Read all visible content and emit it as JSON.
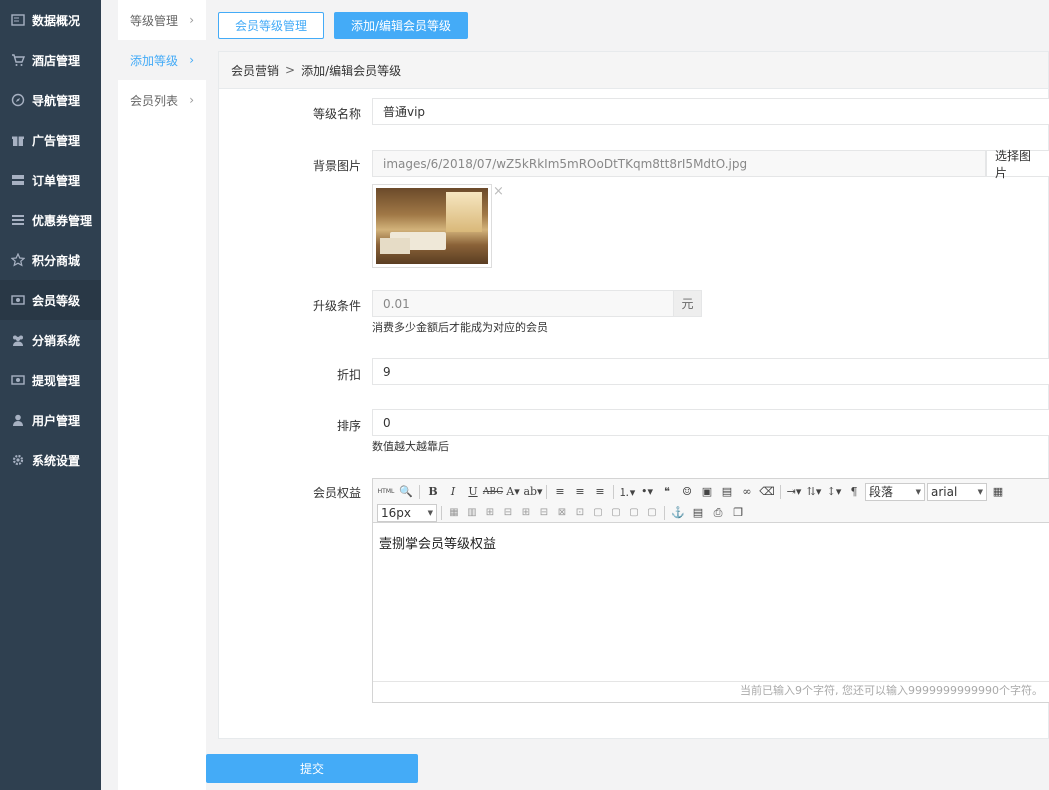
{
  "sidebar": {
    "items": [
      {
        "label": "数据概况",
        "icon": "dashboard-icon"
      },
      {
        "label": "酒店管理",
        "icon": "cart-icon"
      },
      {
        "label": "导航管理",
        "icon": "compass-icon"
      },
      {
        "label": "广告管理",
        "icon": "gift-icon"
      },
      {
        "label": "订单管理",
        "icon": "server-icon"
      },
      {
        "label": "优惠券管理",
        "icon": "list-icon"
      },
      {
        "label": "积分商城",
        "icon": "star-icon"
      },
      {
        "label": "会员等级",
        "icon": "money-icon",
        "active": true
      },
      {
        "label": "分销系统",
        "icon": "users-icon"
      },
      {
        "label": "提现管理",
        "icon": "cash-icon"
      },
      {
        "label": "用户管理",
        "icon": "user-icon"
      },
      {
        "label": "系统设置",
        "icon": "gear-icon"
      }
    ]
  },
  "subnav": {
    "items": [
      {
        "label": "等级管理"
      },
      {
        "label": "添加等级",
        "active": true
      },
      {
        "label": "会员列表"
      }
    ]
  },
  "top_buttons": {
    "manage": "会员等级管理",
    "add_edit": "添加/编辑会员等级"
  },
  "breadcrumb": {
    "parent": "会员营销",
    "separator": ">",
    "current": "添加/编辑会员等级"
  },
  "form": {
    "name_label": "等级名称",
    "name_value": "普通vip",
    "bg_label": "背景图片",
    "bg_value": "images/6/2018/07/wZ5kRkIm5mROoDtTKqm8tt8rI5MdtO.jpg",
    "bg_button": "选择图片",
    "bg_remove": "×",
    "upgrade_label": "升级条件",
    "upgrade_value": "0.01",
    "upgrade_unit": "元",
    "upgrade_hint": "消费多少金额后才能成为对应的会员",
    "discount_label": "折扣",
    "discount_value": "9",
    "sort_label": "排序",
    "sort_value": "0",
    "sort_hint": "数值越大越靠后",
    "benefit_label": "会员权益"
  },
  "editor": {
    "paragraph_select": "段落",
    "font_select": "arial",
    "size_select": "16px",
    "content": "壹捌掌会员等级权益",
    "footer": "当前已输入9个字符, 您还可以输入9999999999990个字符。"
  },
  "submit_label": "提交",
  "colors": {
    "sidebar_bg": "#2f4050",
    "accent": "#44abf7"
  }
}
